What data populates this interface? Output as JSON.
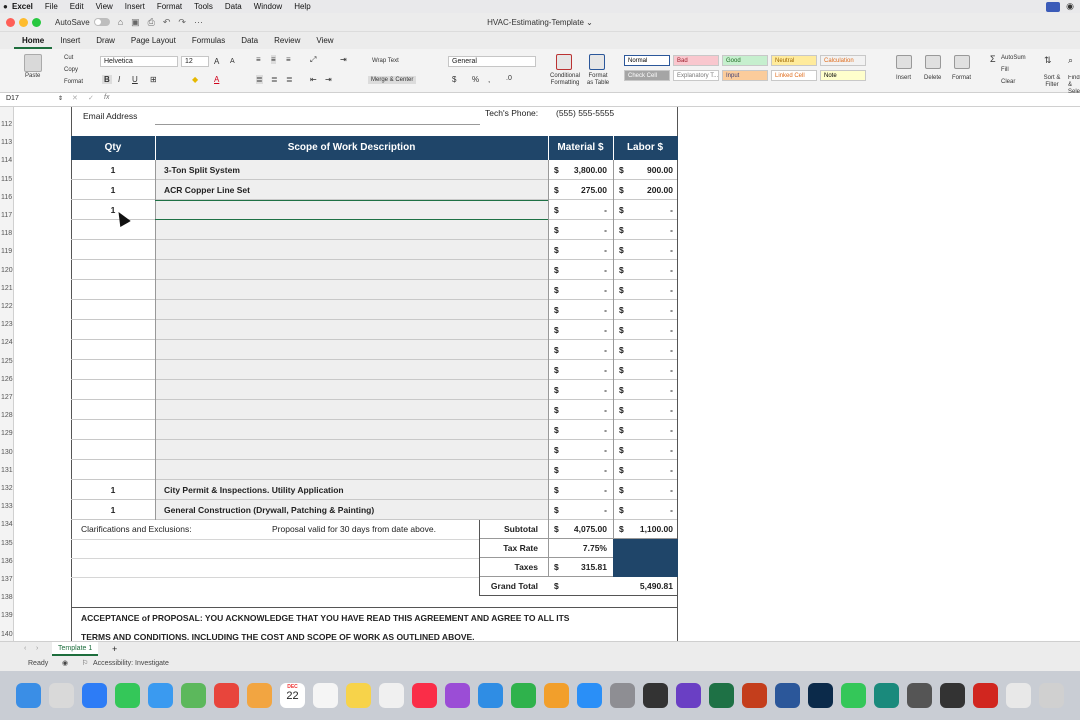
{
  "menubar": {
    "items": [
      "Excel",
      "File",
      "Edit",
      "View",
      "Insert",
      "Format",
      "Tools",
      "Data",
      "Window",
      "Help"
    ]
  },
  "titlebar": {
    "autosave": "AutoSave",
    "doc_title": "HVAC-Estimating-Template ⌄"
  },
  "ribbon": {
    "tabs": [
      "Home",
      "Insert",
      "Draw",
      "Page Layout",
      "Formulas",
      "Data",
      "Review",
      "View"
    ],
    "paste": "Paste",
    "cut": "Cut",
    "copy": "Copy",
    "format": "Format",
    "font_name": "Helvetica",
    "font_size": "12",
    "wrap_text": "Wrap Text",
    "merge_center": "Merge & Center",
    "number_format": "General",
    "cond_format": "Conditional Formatting",
    "format_table": "Format as Table",
    "styles": [
      {
        "label": "Normal",
        "bg": "#ffffff",
        "fg": "#000000"
      },
      {
        "label": "Bad",
        "bg": "#f9c7ce",
        "fg": "#9c1c2a"
      },
      {
        "label": "Good",
        "bg": "#c6efce",
        "fg": "#1f6b22"
      },
      {
        "label": "Neutral",
        "bg": "#ffeb9c",
        "fg": "#9c6500"
      },
      {
        "label": "Calculation",
        "bg": "#f2f2f2",
        "fg": "#e06c1b"
      },
      {
        "label": "Check Cell",
        "bg": "#a5a5a5",
        "fg": "#ffffff"
      },
      {
        "label": "Explanatory T...",
        "bg": "#ffffff",
        "fg": "#777777"
      },
      {
        "label": "Input",
        "bg": "#fbcc9b",
        "fg": "#3f3f76"
      },
      {
        "label": "Linked Cell",
        "bg": "#ffffff",
        "fg": "#e06c1b"
      },
      {
        "label": "Note",
        "bg": "#ffffcc",
        "fg": "#000000"
      }
    ],
    "insert": "Insert",
    "delete": "Delete",
    "format_cells": "Format",
    "autosum": "AutoSum",
    "fill": "Fill",
    "clear": "Clear",
    "sort_filter": "Sort & Filter",
    "find_select": "Find & Select"
  },
  "formula_bar": {
    "name_box": "D17",
    "fx": "fx",
    "content": ""
  },
  "row_numbers": [
    "112",
    "113",
    "114",
    "115",
    "116",
    "117",
    "118",
    "119",
    "120",
    "121",
    "122",
    "123",
    "124",
    "125",
    "126",
    "127",
    "128",
    "129",
    "130",
    "131",
    "132",
    "133",
    "134",
    "135",
    "136",
    "137",
    "138",
    "139",
    "140"
  ],
  "form": {
    "email_label": "Email Address",
    "tech_phone_label": "Tech's Phone:",
    "tech_phone": "(555) 555-5555",
    "headers": {
      "qty": "Qty",
      "desc": "Scope of Work Description",
      "material": "Material $",
      "labor": "Labor $"
    },
    "currency": "$",
    "rows": [
      {
        "qty": "1",
        "desc": "3-Ton Split System",
        "material": "3,800.00",
        "labor": "900.00"
      },
      {
        "qty": "1",
        "desc": "ACR Copper Line Set",
        "material": "275.00",
        "labor": "200.00"
      },
      {
        "qty": "1",
        "desc": "",
        "material": "-",
        "labor": "-"
      },
      {
        "qty": "",
        "desc": "",
        "material": "-",
        "labor": "-"
      },
      {
        "qty": "",
        "desc": "",
        "material": "-",
        "labor": "-"
      },
      {
        "qty": "",
        "desc": "",
        "material": "-",
        "labor": "-"
      },
      {
        "qty": "",
        "desc": "",
        "material": "-",
        "labor": "-"
      },
      {
        "qty": "",
        "desc": "",
        "material": "-",
        "labor": "-"
      },
      {
        "qty": "",
        "desc": "",
        "material": "-",
        "labor": "-"
      },
      {
        "qty": "",
        "desc": "",
        "material": "-",
        "labor": "-"
      },
      {
        "qty": "",
        "desc": "",
        "material": "-",
        "labor": "-"
      },
      {
        "qty": "",
        "desc": "",
        "material": "-",
        "labor": "-"
      },
      {
        "qty": "",
        "desc": "",
        "material": "-",
        "labor": "-"
      },
      {
        "qty": "",
        "desc": "",
        "material": "-",
        "labor": "-"
      },
      {
        "qty": "",
        "desc": "",
        "material": "-",
        "labor": "-"
      },
      {
        "qty": "",
        "desc": "",
        "material": "-",
        "labor": "-"
      },
      {
        "qty": "1",
        "desc": "City Permit & Inspections. Utility Application",
        "material": "-",
        "labor": "-"
      },
      {
        "qty": "1",
        "desc": "General Construction (Drywall, Patching & Painting)",
        "material": "-",
        "labor": "-"
      }
    ],
    "clarifications_label": "Clarifications and Exclusions:",
    "proposal_note": "Proposal valid for 30 days from date above.",
    "subtotal_label": "Subtotal",
    "subtotal_material": "4,075.00",
    "subtotal_labor": "1,100.00",
    "tax_rate_label": "Tax Rate",
    "tax_rate": "7.75%",
    "taxes_label": "Taxes",
    "taxes": "315.81",
    "grand_total_label": "Grand Total",
    "grand_total": "5,490.81",
    "acceptance_line1": "ACCEPTANCE of PROPOSAL: YOU ACKNOWLEDGE THAT YOU HAVE READ THIS AGREEMENT AND AGREE TO ALL ITS",
    "acceptance_line2": "TERMS AND CONDITIONS. INCLUDING THE COST AND SCOPE OF WORK AS OUTLINED ABOVE."
  },
  "sheet_tabs": {
    "active": "Template 1",
    "add": "+"
  },
  "status": {
    "ready": "Ready",
    "accessibility": "Accessibility: Investigate"
  },
  "dock": {
    "date_month": "DEC",
    "date_day": "22",
    "apps": [
      {
        "name": "finder",
        "color": "#3a8ee6"
      },
      {
        "name": "launchpad",
        "color": "#d9d9d9"
      },
      {
        "name": "safari",
        "color": "#2d7cf6"
      },
      {
        "name": "messages",
        "color": "#34c759"
      },
      {
        "name": "mail",
        "color": "#3a9af0"
      },
      {
        "name": "maps",
        "color": "#5cb85c"
      },
      {
        "name": "chrome",
        "color": "#e8453c"
      },
      {
        "name": "photos",
        "color": "#f2a541"
      },
      {
        "name": "calendar",
        "color": "#ffffff"
      },
      {
        "name": "reminders",
        "color": "#f5f5f5"
      },
      {
        "name": "notes",
        "color": "#f7d34a"
      },
      {
        "name": "freeform",
        "color": "#f0f0f0"
      },
      {
        "name": "music",
        "color": "#fa2d48"
      },
      {
        "name": "podcasts",
        "color": "#9b4dd6"
      },
      {
        "name": "keynote",
        "color": "#2f8de4"
      },
      {
        "name": "numbers",
        "color": "#2fb24c"
      },
      {
        "name": "pages",
        "color": "#f29f2b"
      },
      {
        "name": "app-store",
        "color": "#2a8ff7"
      },
      {
        "name": "system-settings",
        "color": "#8e8e93"
      },
      {
        "name": "activity-monitor",
        "color": "#333333"
      },
      {
        "name": "imovie",
        "color": "#6a3fc4"
      },
      {
        "name": "excel",
        "color": "#1e7145"
      },
      {
        "name": "powerpoint",
        "color": "#c43e1c"
      },
      {
        "name": "word",
        "color": "#2b579a"
      },
      {
        "name": "photoshop",
        "color": "#0b2a4a"
      },
      {
        "name": "facetime",
        "color": "#34c759"
      },
      {
        "name": "snagit",
        "color": "#1a8a7c"
      },
      {
        "name": "automator",
        "color": "#555555"
      },
      {
        "name": "calculator",
        "color": "#333333"
      },
      {
        "name": "acrobat",
        "color": "#d1261f"
      },
      {
        "name": "script-editor",
        "color": "#e8e8e8"
      },
      {
        "name": "trash",
        "color": "#d0d0d0"
      }
    ]
  }
}
